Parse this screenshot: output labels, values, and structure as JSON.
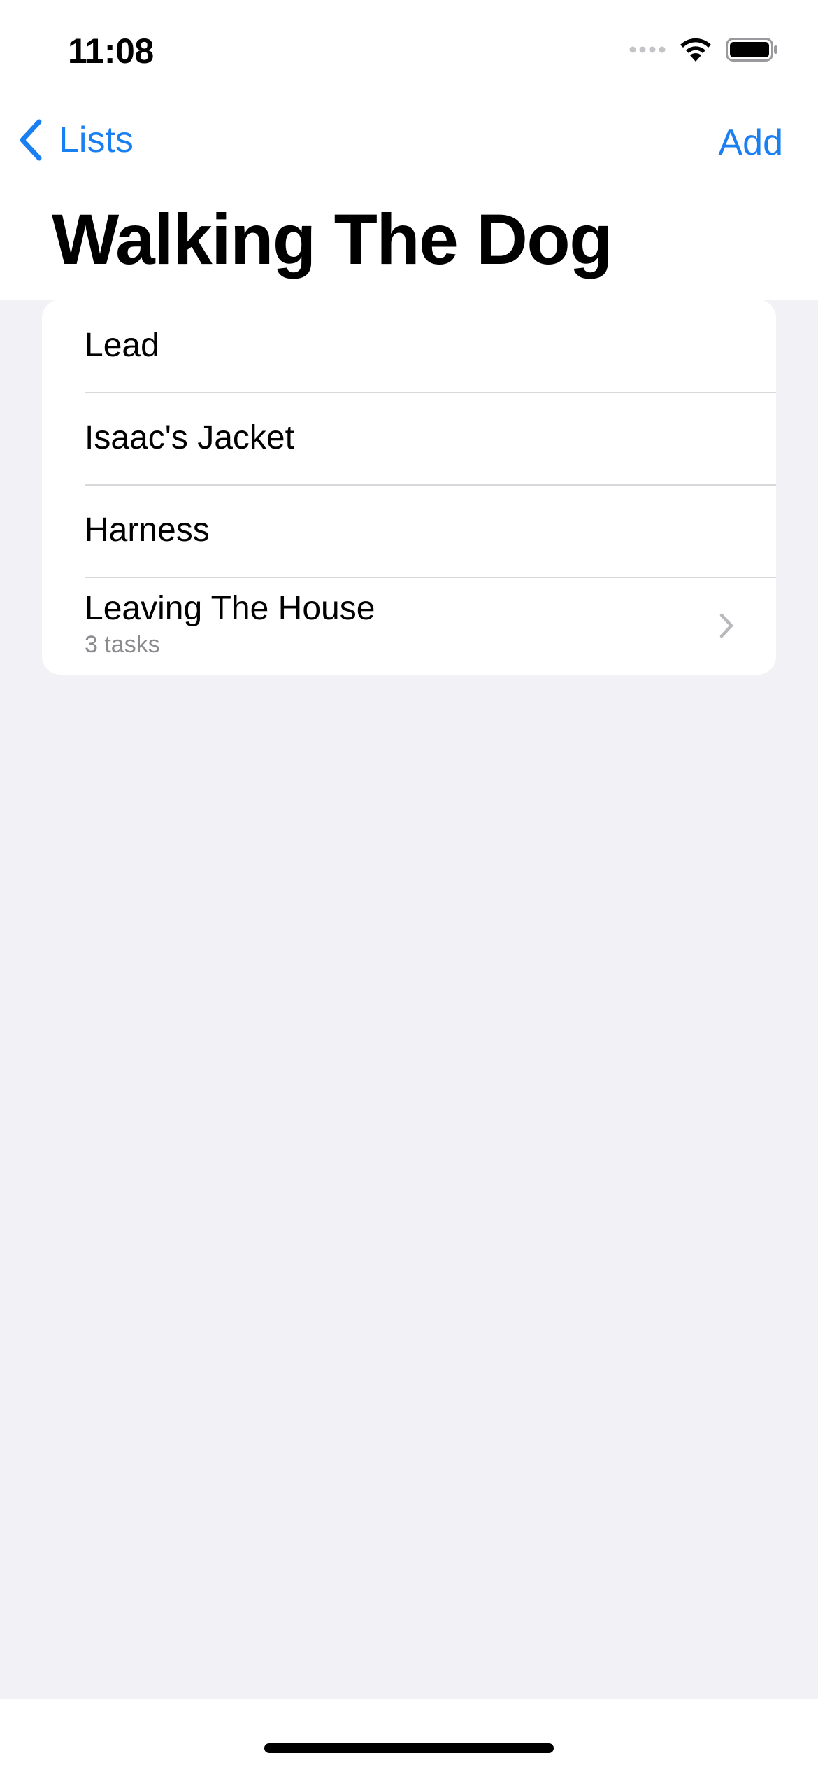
{
  "status_bar": {
    "time": "11:08"
  },
  "nav": {
    "back_label": "Lists",
    "add_label": "Add",
    "title": "Walking The Dog"
  },
  "items": [
    {
      "label": "Lead"
    },
    {
      "label": "Isaac's Jacket"
    },
    {
      "label": "Harness"
    }
  ],
  "groups": [
    {
      "label": "Leaving The House",
      "subtitle": "3 tasks"
    }
  ],
  "colors": {
    "accent": "#1a7ff0",
    "background": "#f1f1f6",
    "card": "#ffffff",
    "separator": "#d8d8dc",
    "secondary_text": "#8a8a8f"
  },
  "icons": [
    "cellular-icon",
    "wifi-icon",
    "battery-icon",
    "back-chevron-icon",
    "chevron-right-icon"
  ]
}
